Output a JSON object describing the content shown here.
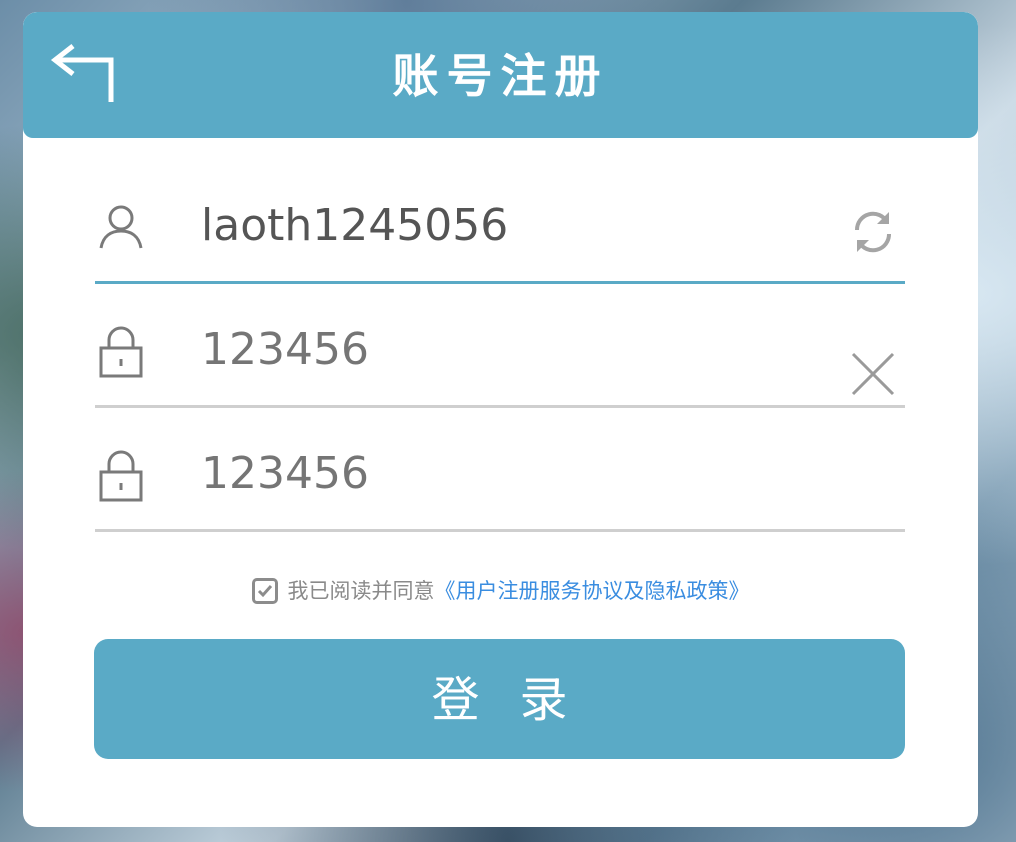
{
  "header": {
    "title": "账号注册",
    "back_icon": "back-arrow-icon"
  },
  "form": {
    "username": {
      "icon": "user-icon",
      "value": "laoth1245056",
      "action_icon": "refresh-icon"
    },
    "password": {
      "icon": "lock-icon",
      "placeholder": "123456",
      "action_icon": "close-icon"
    },
    "confirm_password": {
      "icon": "lock-icon",
      "placeholder": "123456"
    }
  },
  "agreement": {
    "checked": true,
    "text": "我已阅读并同意",
    "link": "《用户注册服务协议及隐私政策》"
  },
  "submit": {
    "label": "登录"
  },
  "colors": {
    "accent": "#5aaac6",
    "link": "#3a8de0",
    "placeholder": "#b9b9b9",
    "divider": "#cfcfcf"
  }
}
